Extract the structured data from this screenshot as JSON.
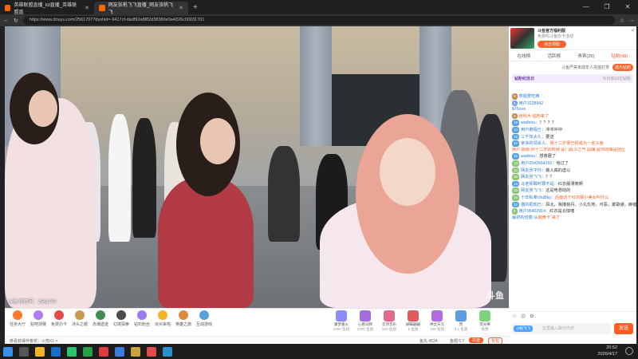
{
  "browser": {
    "tabs": [
      {
        "label": "英雄联盟直播_lol直播_英雄联盟直"
      },
      {
        "label": "网友张帆飞飞直播_网友张帆飞飞"
      }
    ],
    "url": "https://www.douyu.com/2561707?dyshid=-9417cf-dadf92a8f82d38380e0a4326c00031701",
    "window_controls": [
      "—",
      "❐",
      "✕"
    ]
  },
  "video": {
    "room_watermark": "斗鱼 房间号：2561707",
    "logo": "斗鱼"
  },
  "gift_bar": {
    "items": [
      {
        "label": "任务大厅",
        "color": "#ff7a2c"
      },
      {
        "label": "贴吧测赛",
        "color": "#b07cf5"
      },
      {
        "label": "免费办卡",
        "color": "#e84a4a"
      },
      {
        "label": "沐头之眼",
        "color": "#c89a4b"
      },
      {
        "label": "赤潮遗迹",
        "color": "#3f8c52"
      },
      {
        "label": "幻境探索",
        "color": "#4b4b4b"
      },
      {
        "label": "钻石粉丝",
        "color": "#9a7cf0"
      },
      {
        "label": "派对来啦",
        "color": "#f3b429"
      },
      {
        "label": "英雄之旅",
        "color": "#d78d3b"
      },
      {
        "label": "互动游戏",
        "color": "#58a0de"
      }
    ],
    "paid_gifts": [
      {
        "name": "康梦嘉火",
        "price": "2000 鱼翅",
        "color": "#8b8bff"
      },
      {
        "name": "心愿词牌",
        "price": "2000 鱼翅",
        "color": "#a56be0"
      },
      {
        "name": "云顶音乐",
        "price": "500 鱼翅",
        "color": "#e06b8b"
      },
      {
        "name": "蝴蝶翩翩",
        "price": "5 鱼翅",
        "color": "#e05b5b"
      },
      {
        "name": "神灵天马",
        "price": "100 鱼翅",
        "color": "#b36be0"
      },
      {
        "name": "赞",
        "price": "0.1 鱼翅",
        "color": "#5b9be0"
      },
      {
        "name": "荧光棒",
        "price": "免费",
        "color": "#7ed37e"
      }
    ]
  },
  "bottom_row": {
    "notice": "恭喜获得伴奏奖：火箭X1 >",
    "fish_balls": "鱼丸 4524",
    "fins": "鱼翅 0.7",
    "recharge_label": "充值",
    "bag_label": "背包"
  },
  "side_panel": {
    "ad": {
      "title": "斗鱼官方福利服",
      "subtitle": "免费吗斗鱼办卡活动",
      "button": "点击领取"
    },
    "rank_tabs": [
      {
        "label": "在线榜",
        "active": false
      },
      {
        "label": "活跃榜",
        "active": false
      },
      {
        "label": "贵宾(25)",
        "active": false
      },
      {
        "label": "钻粉(48)",
        "active": true
      }
    ],
    "fan_prompt": "斗鱼严禁未成年人充值打赏",
    "fan_button": "成为钻粉",
    "badge_title": "钻粉纪念日",
    "badge_subtitle": "今日有10位钻粉",
    "messages": [
      {
        "level": "8",
        "lvcolor": "#c58b4f",
        "nick": "燕姐爱吃西",
        "text": ""
      },
      {
        "level": "9",
        "lvcolor": "#6fa4e0",
        "nick": "用户3228942",
        "text": ""
      },
      {
        "level": "",
        "lvcolor": "#999",
        "nick": "$75ovo",
        "text": ""
      },
      {
        "level": "3",
        "lvcolor": "#c58b4f",
        "nick": "",
        "text": "芭科大 钻粉来了",
        "highlight": true
      },
      {
        "level": "19",
        "lvcolor": "#58a0de",
        "nick": "wadnou：",
        "text": "？？？？"
      },
      {
        "level": "13",
        "lvcolor": "#58a0de",
        "nick": "用户鹏程仕：",
        "text": "冲冲冲冲"
      },
      {
        "level": "16",
        "lvcolor": "#58a0de",
        "nick": "三千年太久：",
        "text": "要送"
      },
      {
        "level": "22",
        "lvcolor": "#58a0de",
        "nick": "家多的领杀人：",
        "text": "我十二岁便已经成为一名斗鱼",
        "highlight": true
      },
      {
        "level": "",
        "lvcolor": "#999",
        "nick": "",
        "text": "用户 斯斯 你十二岁的时候 是门段斗之气 段嗨 是你的嘴是捏压",
        "highlight": true
      },
      {
        "level": "16",
        "lvcolor": "#58a0de",
        "nick": "wadnou：",
        "text": "想像展了"
      },
      {
        "level": "13",
        "lvcolor": "#8ac878",
        "nick": "用户2542664292：",
        "text": "哈过了"
      },
      {
        "level": "14",
        "lvcolor": "#8ac878",
        "nick": "网友张平你：",
        "text": "做人真的虚以"
      },
      {
        "level": "16",
        "lvcolor": "#8ac878",
        "nick": "网友张飞飞：",
        "text": "？？"
      },
      {
        "level": "18",
        "lvcolor": "#58a0de",
        "nick": "马老师瞬时罪不是：",
        "text": "红衣服漂亮啊"
      },
      {
        "level": "16",
        "lvcolor": "#8ac878",
        "nick": "网友张飞飞：",
        "text": "这是电想动的"
      },
      {
        "level": "14",
        "lvcolor": "#8ac878",
        "nick": "十年私奉chuBky：",
        "text": "后面这个红衣服小美女叫什么",
        "highlight": true
      },
      {
        "level": "22",
        "lvcolor": "#58a0de",
        "nick": "撸的把知已：",
        "text": "昂北，我撸桃丹，小丸仇地，可恶，欺歌通，麻嘘，鱼仔，大帝粉了"
      },
      {
        "level": "9",
        "lvcolor": "#8ac878",
        "nick": "用户96402914：",
        "text": "红衣是云琪噢"
      },
      {
        "level": "",
        "lvcolor": "#999",
        "nick": "最初的佳丽 从",
        "text": "越黄卡 来了",
        "highlight": true
      }
    ],
    "input_placeholder": "这里输入聊天内容",
    "fan_badge": "小帆飞飞",
    "send_label": "发送"
  },
  "taskbar": {
    "time": "20:52",
    "date": "2026/4/17"
  }
}
